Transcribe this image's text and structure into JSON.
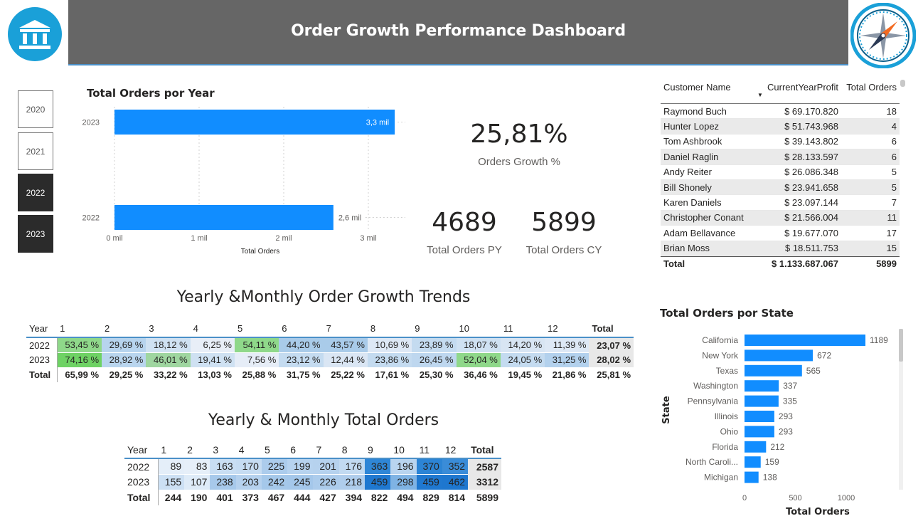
{
  "header": {
    "title": "Order Growth Performance Dashboard",
    "logo_icon": "bank-icon",
    "compass_icon": "compass-icon"
  },
  "slicer": {
    "years": [
      {
        "label": "2020",
        "selected": false
      },
      {
        "label": "2021",
        "selected": false
      },
      {
        "label": "2022",
        "selected": true
      },
      {
        "label": "2023",
        "selected": true
      }
    ]
  },
  "year_chart": {
    "title": "Total Orders por Year",
    "chart_data": {
      "type": "bar",
      "orientation": "horizontal",
      "categories": [
        "2023",
        "2022"
      ],
      "values": [
        3312,
        2587
      ],
      "data_labels": [
        "3,3 mil",
        "2,6 mil"
      ],
      "x_ticks": [
        "0 mil",
        "1 mil",
        "2 mil",
        "3 mil"
      ],
      "xlabel": "Total Orders",
      "xlim": [
        0,
        3500
      ],
      "color": "#118dff"
    }
  },
  "kpis": {
    "growth": {
      "value": "25,81%",
      "label": "Orders Growth %"
    },
    "py": {
      "value": "4689",
      "label": "Total Orders PY"
    },
    "cy": {
      "value": "5899",
      "label": "Total Orders CY"
    }
  },
  "customers": {
    "headers": [
      "Customer Name",
      "CurrentYearProfit",
      "Total Orders"
    ],
    "rows": [
      [
        "Raymond Buch",
        "$ 69.170.820",
        "18"
      ],
      [
        "Hunter Lopez",
        "$ 51.743.968",
        "4"
      ],
      [
        "Tom Ashbrook",
        "$ 39.143.802",
        "6"
      ],
      [
        "Daniel Raglin",
        "$ 28.133.597",
        "6"
      ],
      [
        "Andy Reiter",
        "$ 26.086.348",
        "5"
      ],
      [
        "Bill Shonely",
        "$ 23.941.658",
        "5"
      ],
      [
        "Karen Daniels",
        "$ 23.097.144",
        "7"
      ],
      [
        "Christopher Conant",
        "$ 21.566.004",
        "11"
      ],
      [
        "Adam Bellavance",
        "$ 19.677.070",
        "17"
      ],
      [
        "Brian Moss",
        "$ 18.511.753",
        "15"
      ]
    ],
    "total": [
      "Total",
      "$ 1.133.687.067",
      "5899"
    ]
  },
  "growth_matrix": {
    "title": "Yearly &Monthly Order Growth Trends",
    "headers": [
      "Year",
      "1",
      "2",
      "3",
      "4",
      "5",
      "6",
      "7",
      "8",
      "9",
      "10",
      "11",
      "12",
      "Total"
    ],
    "rows": [
      {
        "year": "2022",
        "cells": [
          "53,45 %",
          "29,69 %",
          "18,12 %",
          "6,25 %",
          "54,11 %",
          "44,20 %",
          "43,57 %",
          "10,69 %",
          "23,89 %",
          "18,07 %",
          "14,20 %",
          "11,39 %"
        ],
        "colors": [
          "#8fd88a",
          "#b7d4ee",
          "#cfe1f2",
          "#e8eef7",
          "#8fd88a",
          "#a9cbe9",
          "#a9cbe9",
          "#dde8f5",
          "#c4dbf0",
          "#cfe1f2",
          "#d8e5f3",
          "#dde8f5"
        ],
        "total": "23,07 %"
      },
      {
        "year": "2023",
        "cells": [
          "74,16 %",
          "28,92 %",
          "46,01 %",
          "19,41 %",
          "7,56 %",
          "23,12 %",
          "12,44 %",
          "23,86 %",
          "26,45 %",
          "52,04 %",
          "24,05 %",
          "31,25 %"
        ],
        "colors": [
          "#6ed264",
          "#b9d5ee",
          "#9fd6a0",
          "#cfe1f2",
          "#e6edf7",
          "#c4dbf0",
          "#dae6f4",
          "#c4dbf0",
          "#bed7ef",
          "#8fd88a",
          "#c4dbf0",
          "#b3d1ed"
        ],
        "total": "28,02 %"
      }
    ],
    "total_row": [
      "Total",
      "65,99 %",
      "29,25 %",
      "33,22 %",
      "13,03 %",
      "25,88 %",
      "31,75 %",
      "25,22 %",
      "17,61 %",
      "25,30 %",
      "36,46 %",
      "19,45 %",
      "21,86 %",
      "25,81 %"
    ]
  },
  "orders_matrix": {
    "title": "Yearly & Monthly Total Orders",
    "headers": [
      "Year",
      "1",
      "2",
      "3",
      "4",
      "5",
      "6",
      "7",
      "8",
      "9",
      "10",
      "11",
      "12",
      "Total"
    ],
    "rows": [
      {
        "year": "2022",
        "cells": [
          "89",
          "83",
          "163",
          "170",
          "225",
          "199",
          "201",
          "176",
          "363",
          "196",
          "370",
          "352"
        ],
        "colors": [
          "#e4eef9",
          "#e6eff9",
          "#c9def3",
          "#c6dcf2",
          "#acccec",
          "#b7d3ef",
          "#b6d2ee",
          "#c2daf1",
          "#2f86d6",
          "#b9d4ef",
          "#2c84d5",
          "#3a8cd8"
        ],
        "total": "2587"
      },
      {
        "year": "2023",
        "cells": [
          "155",
          "107",
          "238",
          "203",
          "242",
          "245",
          "226",
          "218",
          "459",
          "298",
          "459",
          "462"
        ],
        "colors": [
          "#cce0f4",
          "#deebf8",
          "#a7c9eb",
          "#b5d1ee",
          "#a5c8ea",
          "#a4c7ea",
          "#acccec",
          "#afcdec",
          "#1f78d0",
          "#7fb3e4",
          "#1f78d0",
          "#1e77cf"
        ],
        "total": "3312"
      }
    ],
    "total_row": [
      "Total",
      "244",
      "190",
      "401",
      "373",
      "467",
      "444",
      "427",
      "394",
      "822",
      "494",
      "829",
      "814",
      "5899"
    ]
  },
  "state_chart": {
    "title": "Total Orders por State",
    "chart_data": {
      "type": "bar",
      "orientation": "horizontal",
      "categories": [
        "California",
        "New York",
        "Texas",
        "Washington",
        "Pennsylvania",
        "Illinois",
        "Ohio",
        "Florida",
        "North Caroli...",
        "Michigan"
      ],
      "values": [
        1189,
        672,
        565,
        337,
        335,
        293,
        293,
        212,
        159,
        138
      ],
      "x_ticks": [
        "0",
        "500",
        "1000"
      ],
      "xlabel": "Total Orders",
      "ylabel": "State",
      "xlim": [
        0,
        1350
      ],
      "color": "#118dff"
    }
  }
}
